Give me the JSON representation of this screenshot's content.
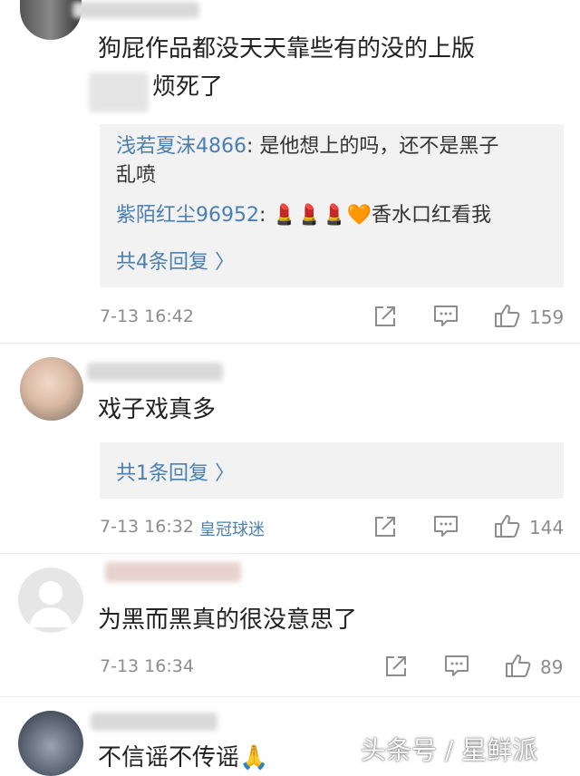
{
  "comments": [
    {
      "text_line1": "狗屁作品都没天天靠些有的没的上版",
      "text_line2": "烦死了",
      "replies": [
        {
          "user": "浅若夏沫4866",
          "text_line1": ": 是他想上的吗，还不是黑子",
          "text_line2": "乱喷"
        },
        {
          "user": "紫陌红尘96952",
          "text": ": 💄💄💄🧡香水口红看我"
        }
      ],
      "more_replies": "共4条回复 〉",
      "time": "7-13 16:42",
      "likes": "159"
    },
    {
      "text": "戏子戏真多",
      "more_replies": "共1条回复 〉",
      "time": "7-13 16:32",
      "badge": "皇冠球迷",
      "likes": "144"
    },
    {
      "text": "为黑而黑真的很没意思了",
      "time": "7-13 16:34",
      "likes": "89"
    },
    {
      "text": "不信谣不传谣🙏"
    }
  ],
  "watermark": "头条号 / 星鲜派",
  "icons": {
    "share": "share-icon",
    "comment": "comment-icon",
    "like": "thumbs-up-icon"
  },
  "colors": {
    "link": "#4a7fb0",
    "meta": "#8c8c8c",
    "reply_bg": "#f2f2f2"
  }
}
